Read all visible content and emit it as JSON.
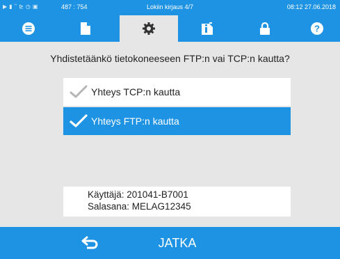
{
  "status_bar": {
    "icons": [
      "play-icon",
      "document-icon",
      "hash-icon",
      "chart-icon",
      "clock-icon",
      "lock-icon"
    ],
    "coords": "487 : 754",
    "title": "Lokiin kirjaus 4/7",
    "datetime": "08:12 27.06.2018"
  },
  "tabs": [
    {
      "icon": "list-icon",
      "active": false
    },
    {
      "icon": "file-icon",
      "active": false
    },
    {
      "icon": "gear-icon",
      "active": true
    },
    {
      "icon": "info-document-icon",
      "active": false
    },
    {
      "icon": "lock-icon",
      "active": false
    },
    {
      "icon": "help-icon",
      "active": false
    }
  ],
  "dialog": {
    "question": "Yhdistetäänkö tietokoneeseen FTP:n vai TCP:n kautta?",
    "options": [
      {
        "label": "Yhteys TCP:n kautta",
        "selected": false
      },
      {
        "label": "Yhteys FTP:n kautta",
        "selected": true
      }
    ],
    "credentials": {
      "user": "Käyttäjä: 201041-B7001",
      "password": "Salasana: MELAG12345"
    }
  },
  "bottom_bar": {
    "back_icon": "back-arrow-icon",
    "continue_label": "JATKA"
  },
  "colors": {
    "accent": "#1f93e3",
    "background": "#e6e6e6",
    "unselected_check": "#b5b5b5"
  }
}
